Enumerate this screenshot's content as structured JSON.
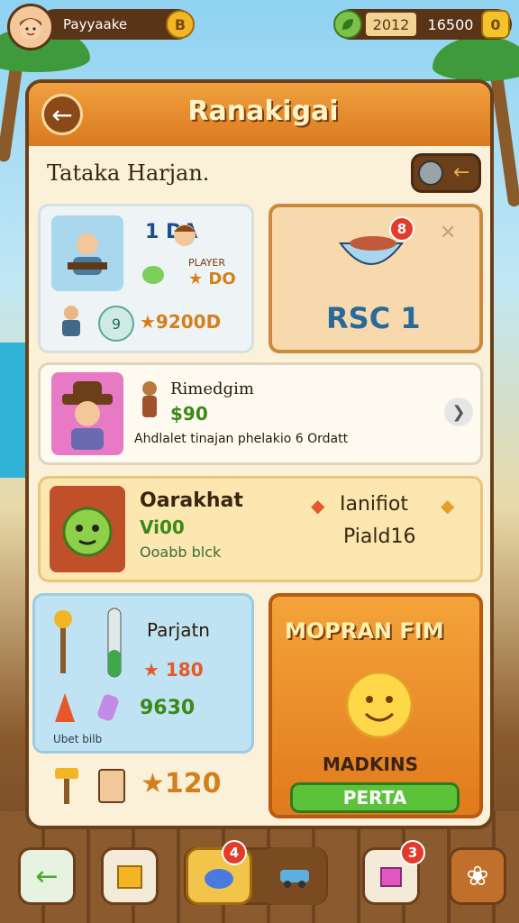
{
  "topbar": {
    "player_name": "Payyaake",
    "gold_label": "B",
    "resource_a": "2012",
    "resource_b": "16500",
    "resource_b_icon_label": "0"
  },
  "panel": {
    "title": "Ranakigai",
    "subtitle": "Tataka Harjan."
  },
  "card_crafters": {
    "label_top": "1 DA",
    "label_mid": "PLAYER",
    "label_stars": "★ DO",
    "price": "★9200D",
    "icon_digit": "9"
  },
  "card_bowl": {
    "badge": "8",
    "label": "RSC 1",
    "close_label": "✕"
  },
  "card_profile": {
    "name": "Rimedgim",
    "price": "$90",
    "desc": "Ahdlalet tinajan phelakio 6 Ordatt"
  },
  "card_monster": {
    "name": "Oarakhat",
    "value": "Vi00",
    "sub": "Ooabb blck",
    "right_title": "Ianifiot",
    "right_sub": "Piald16"
  },
  "card_tools": {
    "title": "Parjatn",
    "row1_value": "★ 180",
    "row2_value": "9630",
    "footer": "Ubet bilb",
    "bottom_value": "★120"
  },
  "card_promo": {
    "banner": "MOPRAN FIM",
    "label": "MADKINS",
    "button": "PERTA"
  },
  "bottom_nav": {
    "badge_center": "4",
    "badge_right": "3"
  },
  "colors": {
    "brown": "#6b3f1a",
    "orange": "#e98a26",
    "green_button": "#5cc23a",
    "cream": "#fbf1d9"
  }
}
